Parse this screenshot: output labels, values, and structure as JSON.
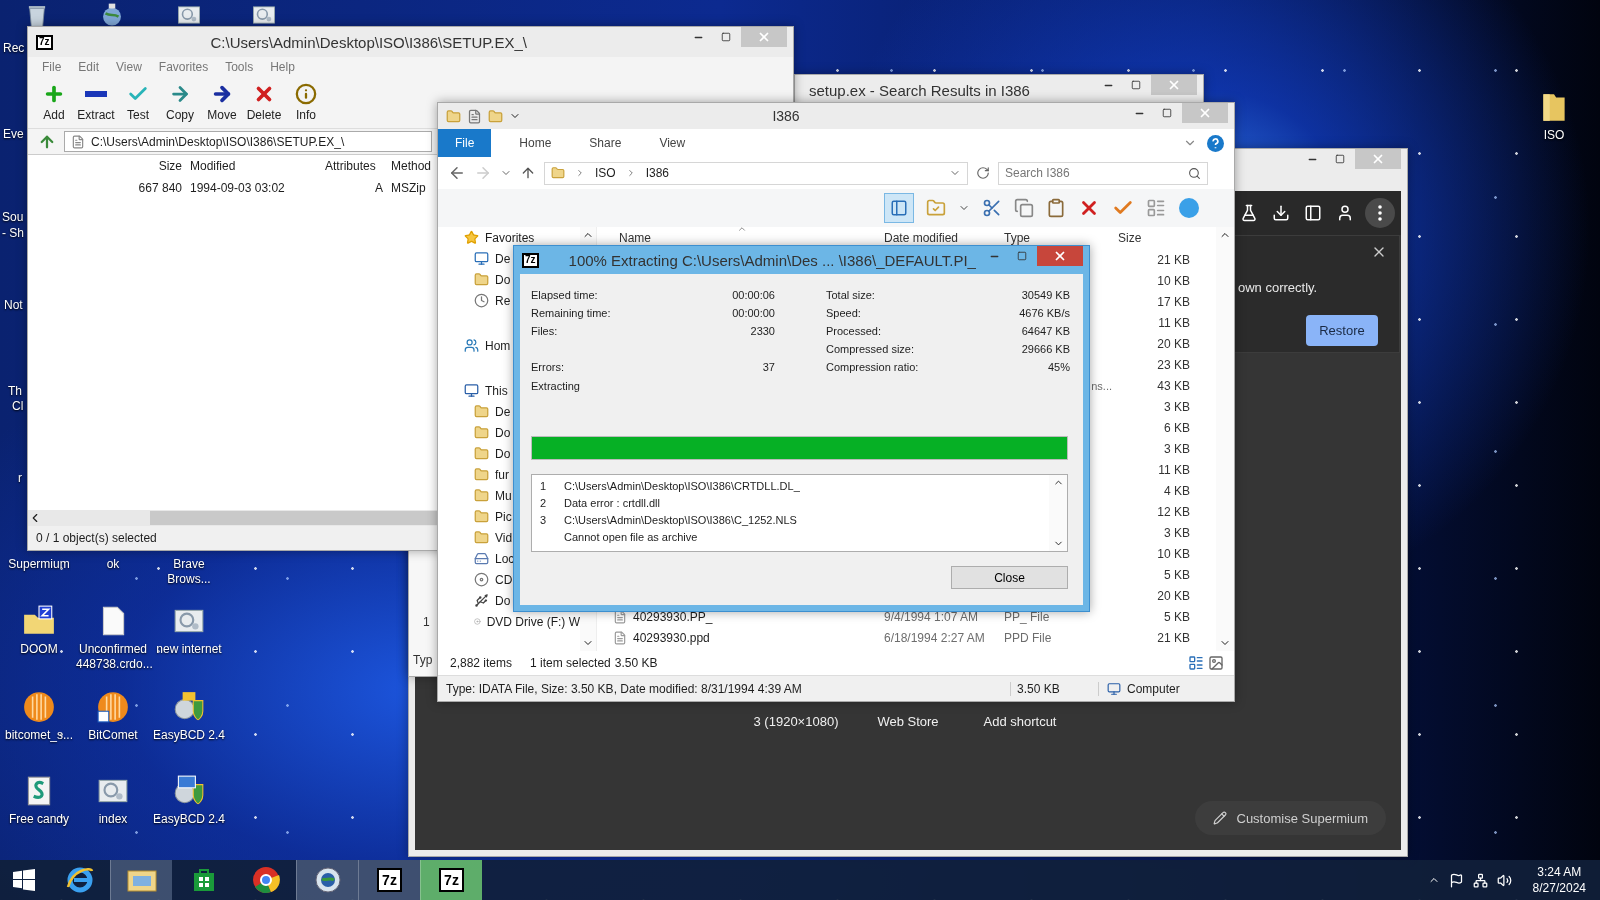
{
  "desktop": {
    "edge_labels": [
      "Rec",
      "Eve",
      "Sou",
      "- Sh",
      "Not",
      "Th",
      "Cl",
      "r"
    ],
    "top_icons": [
      {
        "kind": "recycle"
      },
      {
        "kind": "globe_app"
      },
      {
        "kind": "image_file"
      },
      {
        "kind": "image_file"
      }
    ],
    "icons": [
      {
        "label": "Supermium",
        "kind": "label"
      },
      {
        "label": "ok",
        "kind": "label"
      },
      {
        "label": "Brave Brows...",
        "kind": "label"
      },
      {
        "label": "DOOM",
        "kind": "doom"
      },
      {
        "label": "Unconfirmed 448738.crdo...",
        "kind": "blank_file"
      },
      {
        "label": "new internet",
        "kind": "image_file"
      },
      {
        "label": "bitcomet_s...",
        "kind": "bitcomet"
      },
      {
        "label": "BitComet",
        "kind": "bitcomet_shortcut"
      },
      {
        "label": "EasyBCD 2.4",
        "kind": "easybcd"
      },
      {
        "label": "Free candy",
        "kind": "script"
      },
      {
        "label": "index",
        "kind": "image_file"
      },
      {
        "label": "EasyBCD 2.4",
        "kind": "easybcd_shortcut"
      }
    ],
    "right_icons": [
      {
        "label": "ISO",
        "kind": "folder"
      }
    ]
  },
  "supermium_window": {
    "notice": "own correctly.",
    "restore": "Restore",
    "shortcuts": [
      "3 (1920×1080)",
      "Web Store",
      "Add shortcut"
    ],
    "customise": "Customise Supermium"
  },
  "search_window": {
    "title": "setup.ex - Search Results in I386"
  },
  "background_window": {
    "texts": [
      "1",
      "Typ"
    ]
  },
  "archive_window": {
    "app_icon": "7z",
    "title": "C:\\Users\\Admin\\Desktop\\ISO\\I386\\SETUP.EX_\\",
    "menu": [
      "File",
      "Edit",
      "View",
      "Favorites",
      "Tools",
      "Help"
    ],
    "toolbar": [
      {
        "label": "Add",
        "kind": "add"
      },
      {
        "label": "Extract",
        "kind": "extract"
      },
      {
        "label": "Test",
        "kind": "test"
      },
      {
        "label": "Copy",
        "kind": "copy"
      },
      {
        "label": "Move",
        "kind": "move"
      },
      {
        "label": "Delete",
        "kind": "delete"
      },
      {
        "label": "Info",
        "kind": "info"
      }
    ],
    "path": "C:\\Users\\Admin\\Desktop\\ISO\\I386\\SETUP.EX_\\",
    "columns": [
      "Size",
      "Modified",
      "Attributes",
      "Method"
    ],
    "rows": [
      [
        "667 840",
        "1994-09-03 03:02",
        "A",
        "MSZip"
      ]
    ],
    "status": "0 / 1 object(s) selected"
  },
  "explorer": {
    "title": "I386",
    "ribbon_tabs": [
      {
        "label": "File",
        "selected": true
      },
      {
        "label": "Home",
        "selected": false
      },
      {
        "label": "Share",
        "selected": false
      },
      {
        "label": "View",
        "selected": false
      }
    ],
    "breadcrumb": [
      "ISO",
      "I386"
    ],
    "search": {
      "placeholder": "Search I386"
    },
    "columns": [
      "Name",
      "Date modified",
      "Type",
      "Size"
    ],
    "nav": [
      {
        "label": "Favorites",
        "kind": "star",
        "children": [
          {
            "label": "De",
            "kind": "desktop"
          },
          {
            "label": "Do",
            "kind": "folder"
          },
          {
            "label": "Re",
            "kind": "recent"
          }
        ]
      },
      {
        "label": "Hom",
        "kind": "homegroup"
      },
      {
        "label": "This",
        "kind": "pc",
        "children": [
          {
            "label": "De",
            "kind": "folder"
          },
          {
            "label": "Do",
            "kind": "folder"
          },
          {
            "label": "Do",
            "kind": "folder"
          },
          {
            "label": "fur",
            "kind": "folder"
          },
          {
            "label": "Mu",
            "kind": "folder"
          },
          {
            "label": "Pic",
            "kind": "folder"
          },
          {
            "label": "Vid",
            "kind": "folder"
          },
          {
            "label": "Loc",
            "kind": "drive"
          },
          {
            "label": "CD",
            "kind": "cd"
          },
          {
            "label": "Do",
            "kind": "usb"
          },
          {
            "label": "DVD Drive (F:) W",
            "kind": "dvd"
          }
        ]
      }
    ],
    "rows": [
      {
        "size": "21 KB"
      },
      {
        "size": "10 KB"
      },
      {
        "size": "17 KB"
      },
      {
        "size": "11 KB"
      },
      {
        "size": "20 KB"
      },
      {
        "size": "23 KB"
      },
      {
        "type": "ns...",
        "size": "43 KB"
      },
      {
        "size": "3 KB"
      },
      {
        "size": "6 KB"
      },
      {
        "size": "3 KB"
      },
      {
        "size": "11 KB"
      },
      {
        "size": "4 KB"
      },
      {
        "size": "12 KB"
      },
      {
        "size": "3 KB"
      },
      {
        "size": "10 KB"
      },
      {
        "size": "5 KB"
      },
      {
        "size": "20 KB"
      },
      {
        "name": "40293930.PP_",
        "date": "9/4/1994 1:07 AM",
        "type": "PP_ File",
        "size": "5 KB"
      },
      {
        "name": "40293930.ppd",
        "date": "6/18/1994 2:27 AM",
        "type": "PPD File",
        "size": "21 KB"
      }
    ],
    "status_count": "2,882 items",
    "status_selected": "1 item selected",
    "status_size": "3.50 KB",
    "details": "Type: IDATA File, Size: 3.50 KB, Date modified: 8/31/1994 4:39 AM",
    "details_size": "3.50 KB",
    "details_location": "Computer"
  },
  "extract_dialog": {
    "app_icon": "7z",
    "title": "100% Extracting C:\\Users\\Admin\\Des ... \\I386\\_DEFAULT.PI_",
    "stats": [
      {
        "left_label": "Elapsed time:",
        "left_value": "00:00:06",
        "right_label": "Total size:",
        "right_value": "30549 KB"
      },
      {
        "left_label": "Remaining time:",
        "left_value": "00:00:00",
        "right_label": "Speed:",
        "right_value": "4676 KB/s"
      },
      {
        "left_label": "Files:",
        "left_value": "2330",
        "right_label": "Processed:",
        "right_value": "64647 KB"
      },
      {
        "right_label": "Compressed size:",
        "right_value": "29666 KB"
      },
      {
        "left_label": "Errors:",
        "left_value": "37",
        "right_label": "Compression ratio:",
        "right_value": "45%"
      }
    ],
    "status": "Extracting",
    "progress": {
      "level": 1
    },
    "log": [
      {
        "num": "1",
        "text": "C:\\Users\\Admin\\Desktop\\ISO\\I386\\CRTDLL.DL_"
      },
      {
        "num": "2",
        "text": "Data error : crtdll.dll"
      },
      {
        "num": "3",
        "text": "C:\\Users\\Admin\\Desktop\\ISO\\I386\\C_1252.NLS"
      },
      {
        "text": "Cannot open file as archive"
      }
    ],
    "button": "Close"
  },
  "taskbar": {
    "apps": [
      {
        "kind": "ie",
        "running": false,
        "selected": false
      },
      {
        "kind": "explorer",
        "running": true,
        "selected": false
      },
      {
        "kind": "store",
        "running": false,
        "selected": false
      },
      {
        "kind": "chrome",
        "running": false,
        "selected": false
      },
      {
        "kind": "globe",
        "running": true,
        "selected": false
      },
      {
        "kind": "sevenzip",
        "label": "7z",
        "running": true,
        "selected": false
      },
      {
        "kind": "sevenzip",
        "label": "7z",
        "running": true,
        "selected": true
      }
    ],
    "time": "3:24 AM",
    "date": "8/27/2024"
  }
}
